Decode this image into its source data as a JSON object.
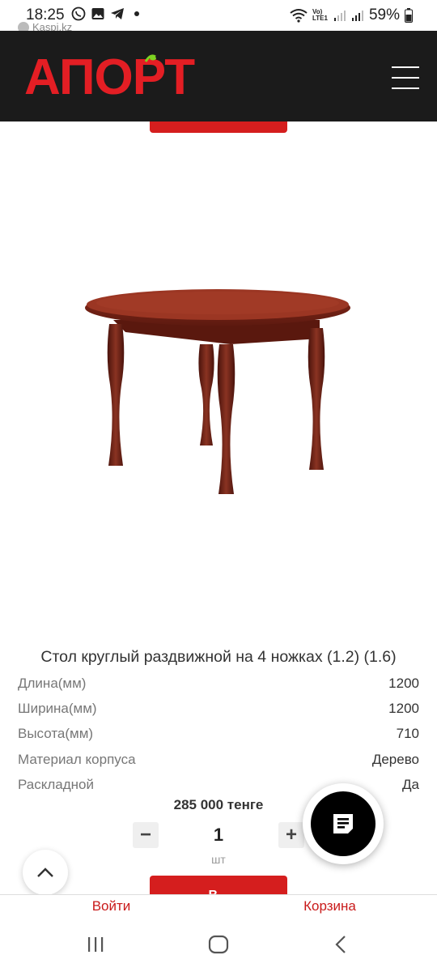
{
  "status_bar": {
    "time": "18:25",
    "battery": "59%",
    "network": "LTE1",
    "notification_source": "Kaspi.kz"
  },
  "header": {
    "logo_text": "АПОРТ",
    "brand_color": "#e31e24",
    "header_bg": "#1b1b1b"
  },
  "product": {
    "title": "Стол круглый раздвижной на 4 ножках (1.2) (1.6)",
    "specs": [
      {
        "label": "Длина(мм)",
        "value": "1200"
      },
      {
        "label": "Ширина(мм)",
        "value": "1200"
      },
      {
        "label": "Высота(мм)",
        "value": "710"
      },
      {
        "label": "Материал корпуса",
        "value": "Дерево"
      },
      {
        "label": "Раскладной",
        "value": "Да"
      }
    ],
    "price": "285 000 тенге",
    "quantity": "1",
    "unit": "шт",
    "add_to_cart_label": "В..."
  },
  "bottom_nav": {
    "login": "Войти",
    "cart": "Корзина"
  },
  "icons": {
    "menu": "hamburger-menu-icon",
    "scroll_top": "chevron-up-icon",
    "chat": "chat-note-icon"
  }
}
